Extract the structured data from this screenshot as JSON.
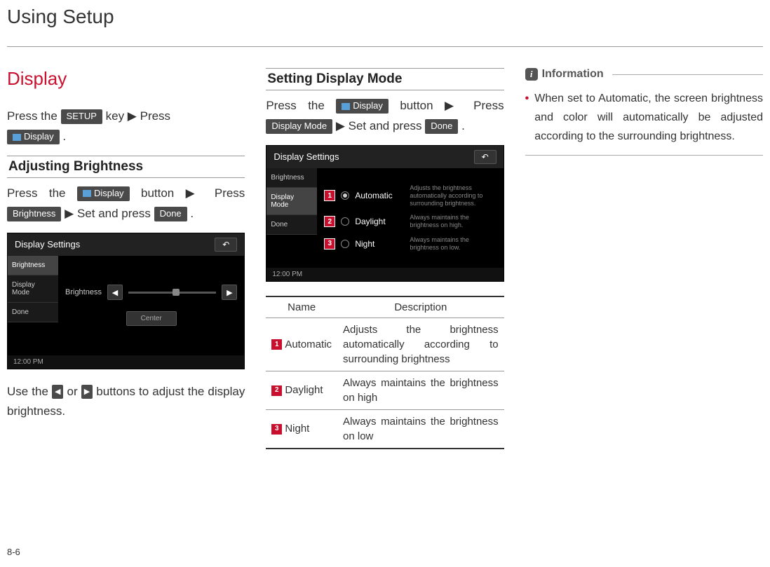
{
  "page": {
    "title": "Using Setup",
    "number": "8-6"
  },
  "col1": {
    "heading": "Display",
    "intro_parts": {
      "p1": "Press the ",
      "pill_setup": "SETUP",
      "p2": " key ▶ Press ",
      "pill_display": "Display",
      "p3": " ."
    },
    "sub_heading": "Adjusting Brightness",
    "steps_parts": {
      "p1": "Press the ",
      "pill_display": "Display",
      "p2": " button ▶ Press ",
      "pill_brightness": "Brightness",
      "p3": " ▶ Set and press ",
      "pill_done": "Done",
      "p4": " ."
    },
    "screenshot": {
      "title": "Display Settings",
      "tabs": {
        "brightness": "Brightness",
        "mode": "Display Mode",
        "done": "Done"
      },
      "slider_label": "Brightness",
      "center": "Center",
      "clock": "12:00 PM"
    },
    "after_parts": {
      "p1": "Use the ",
      "left": "◀",
      "p2": " or ",
      "right": "▶",
      "p3": " buttons to adjust the display brightness."
    }
  },
  "col2": {
    "sub_heading": "Setting Display Mode",
    "steps_parts": {
      "p1": "Press the ",
      "pill_display": "Display",
      "p2": " button ▶ Press ",
      "pill_mode": "Display Mode",
      "p3": " ▶ Set and press ",
      "pill_done": "Done",
      "p4": " ."
    },
    "screenshot": {
      "title": "Display Settings",
      "tabs": {
        "brightness": "Brightness",
        "mode": "Display Mode",
        "done": "Done"
      },
      "options": [
        {
          "num": "1",
          "label": "Automatic",
          "desc": "Adjusts the brightness automatically according to surrounding brightness."
        },
        {
          "num": "2",
          "label": "Daylight",
          "desc": "Always maintains the brightness on high."
        },
        {
          "num": "3",
          "label": "Night",
          "desc": "Always maintains the brightness on low."
        }
      ],
      "clock": "12:00 PM"
    },
    "table": {
      "h_name": "Name",
      "h_desc": "Description",
      "rows": [
        {
          "num": "1",
          "name": "Automatic",
          "desc": "Adjusts the brightness automatically according to surrounding brightness"
        },
        {
          "num": "2",
          "name": "Daylight",
          "desc": "Always maintains the brightness on high"
        },
        {
          "num": "3",
          "name": "Night",
          "desc": "Always maintains the brightness on low"
        }
      ]
    }
  },
  "col3": {
    "info_label": "Information",
    "info_icon": "i",
    "bullet": "When set to Automatic, the screen brightness and color will automatically be adjusted according to the surrounding brightness."
  }
}
